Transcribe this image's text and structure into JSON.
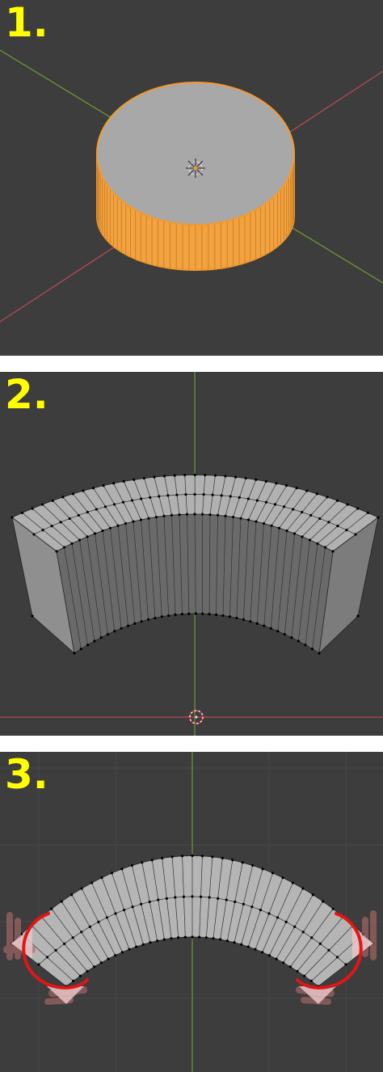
{
  "panels": [
    {
      "label": "1.",
      "content": "cylinder-object-selected"
    },
    {
      "label": "2.",
      "content": "curved-wall-mesh"
    },
    {
      "label": "3.",
      "content": "curved-band-top-view-with-marked-ends"
    }
  ],
  "colors": {
    "viewport_bg": "#3d3d3d",
    "grid_line": "#474747",
    "x_axis": "#b34a52",
    "y_axis": "#6c9a2f",
    "selection_orange": "#f39a2e",
    "mesh_face": "#a9a9a9",
    "mesh_face_dark": "#5e5e5e",
    "annotation_red": "#e01616",
    "label_yellow": "#ffff00"
  }
}
